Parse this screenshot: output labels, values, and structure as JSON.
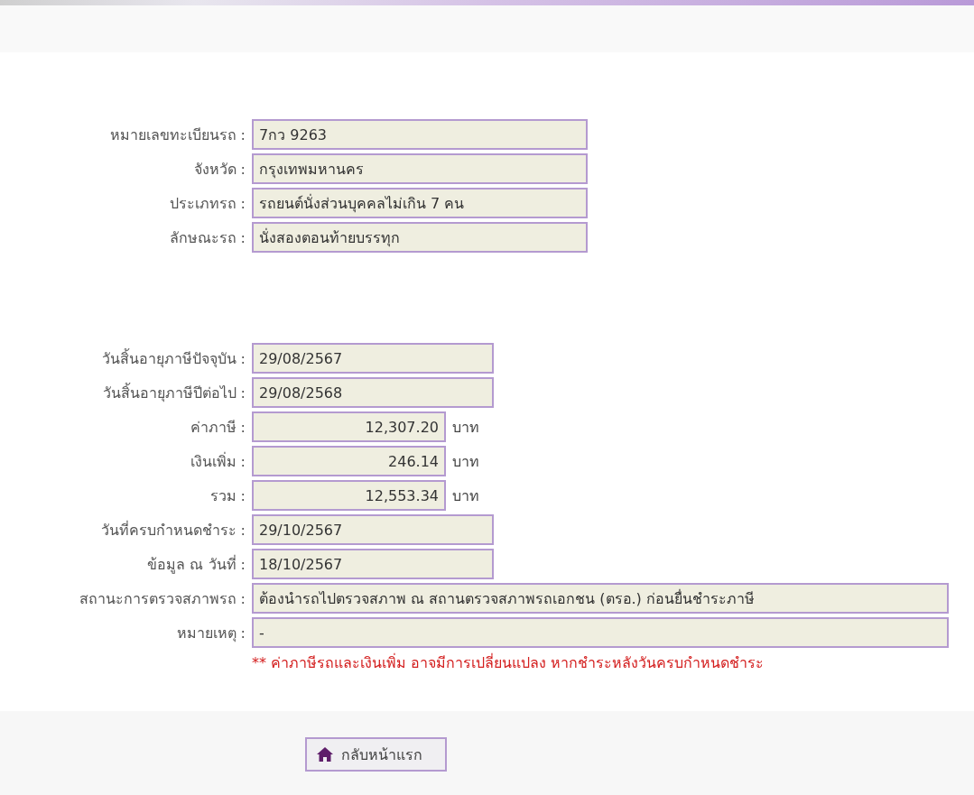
{
  "vehicle": [
    {
      "label": "หมายเลขทะเบียนรถ :",
      "value": "7กว 9263",
      "kind": "medium"
    },
    {
      "label": "จังหวัด :",
      "value": "กรุงเทพมหานคร",
      "kind": "medium"
    },
    {
      "label": "ประเภทรถ :",
      "value": "รถยนต์นั่งส่วนบุคคลไม่เกิน 7 คน",
      "kind": "medium"
    },
    {
      "label": "ลักษณะรถ :",
      "value": "นั่งสองตอนท้ายบรรทุก",
      "kind": "medium"
    }
  ],
  "tax": [
    {
      "label": "วันสิ้นอายุภาษีปัจจุบัน :",
      "value": "29/08/2567",
      "kind": "date"
    },
    {
      "label": "วันสิ้นอายุภาษีปีต่อไป :",
      "value": "29/08/2568",
      "kind": "date"
    },
    {
      "label": "ค่าภาษี :",
      "value": "12,307.20",
      "kind": "money",
      "unit": "บาท"
    },
    {
      "label": "เงินเพิ่ม :",
      "value": "246.14",
      "kind": "money",
      "unit": "บาท"
    },
    {
      "label": "รวม :",
      "value": "12,553.34",
      "kind": "money",
      "unit": "บาท"
    },
    {
      "label": "วันที่ครบกำหนดชำระ :",
      "value": "29/10/2567",
      "kind": "date"
    },
    {
      "label": "ข้อมูล ณ วันที่ :",
      "value": "18/10/2567",
      "kind": "date"
    },
    {
      "label": "สถานะการตรวจสภาพรถ :",
      "value": "ต้องนำรถไปตรวจสภาพ ณ สถานตรวจสภาพรถเอกชน (ตรอ.) ก่อนยื่นชำระภาษี",
      "kind": "long"
    },
    {
      "label": "หมายเหตุ :",
      "value": "-",
      "kind": "long"
    }
  ],
  "warning": "** ค่าภาษีรถและเงินเพิ่ม อาจมีการเปลี่ยนแปลง หากชำระหลังวันครบกำหนดชำระ",
  "home_button": {
    "label": "กลับหน้าแรก"
  }
}
